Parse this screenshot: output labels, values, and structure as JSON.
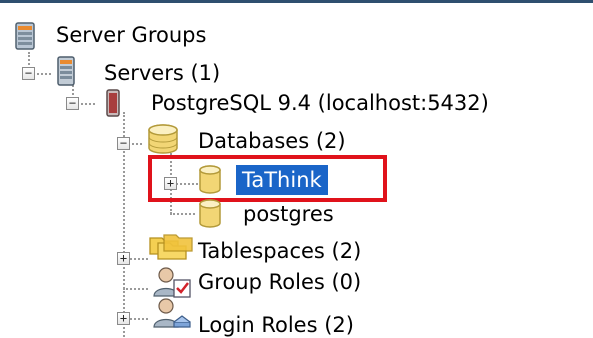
{
  "tree": {
    "root": {
      "label": "Server Groups",
      "icon": "server-group-icon"
    },
    "servers": {
      "label": "Servers (1)",
      "icon": "server-icon",
      "expander": "−"
    },
    "postgres_server": {
      "label": "PostgreSQL 9.4 (localhost:5432)",
      "icon": "postgres-server-icon",
      "expander": "−"
    },
    "databases": {
      "label": "Databases (2)",
      "icon": "databases-icon",
      "expander": "−"
    },
    "db_tathink": {
      "label": "TaThink",
      "icon": "database-icon",
      "expander": "+",
      "selected": true
    },
    "db_postgres": {
      "label": "postgres",
      "icon": "database-icon"
    },
    "tablespaces": {
      "label": "Tablespaces (2)",
      "icon": "tablespaces-icon",
      "expander": "+"
    },
    "group_roles": {
      "label": "Group Roles (0)",
      "icon": "group-roles-icon"
    },
    "login_roles": {
      "label": "Login Roles (2)",
      "icon": "login-roles-icon",
      "expander": "+"
    }
  },
  "colors": {
    "selection": "#1a65c8",
    "annotation_box": "#e0121b",
    "tree_lines": "#9a9a9a"
  }
}
